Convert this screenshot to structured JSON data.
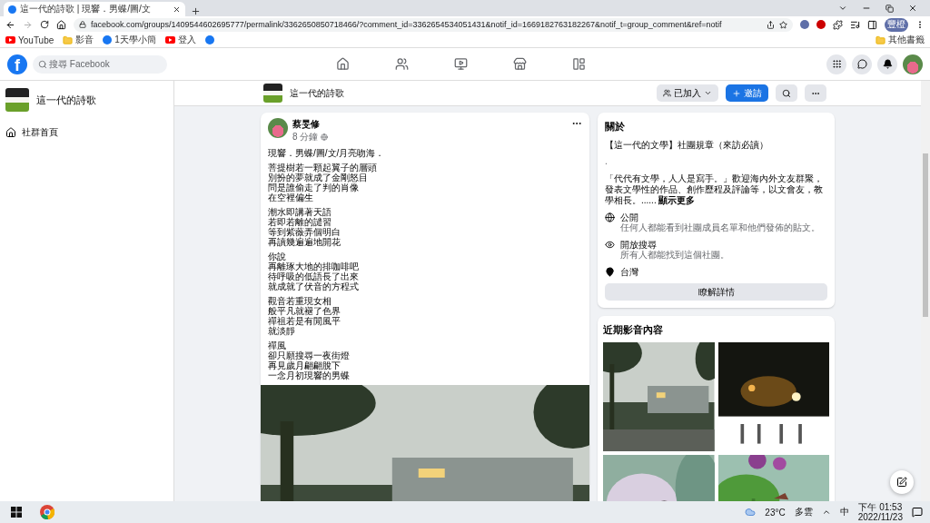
{
  "browser": {
    "tab_title": "這一代的詩歌 | 現響．男蝶/圖/文",
    "url": "facebook.com/groups/1409544602695777/permalink/3362650850718466/?comment_id=3362654534051431&notif_id=1669182763182267&notif_t=group_comment&ref=notif",
    "profile": "豐橙",
    "bookmarks": [
      {
        "kind": "youtube",
        "label": "YouTube"
      },
      {
        "kind": "folder",
        "label": "影音"
      },
      {
        "kind": "facebook",
        "label": "1天學小簡"
      },
      {
        "kind": "youtube",
        "label": "登入"
      },
      {
        "kind": "facebook"
      }
    ],
    "other_bookmarks": "其他書籤"
  },
  "header": {
    "logo": "f",
    "search_placeholder": "搜尋 Facebook"
  },
  "sidebar": {
    "group_name": "這一代的詩歌",
    "items": [
      {
        "label": "社群首頁"
      }
    ]
  },
  "group_bar": {
    "name": "這一代的詩歌",
    "joined": "已加入",
    "invite": "邀請"
  },
  "post": {
    "author": "蔡旻修",
    "time": "8 分鐘",
    "title": "現響．男蝶/圖/文/月亮吻海．",
    "stanzas": [
      [
        "菩提樹若一顆起翼子的層頭",
        "別扮的夢就成了金剛怒目",
        "問是誰偷走了判的肖像",
        "在空裡偏生"
      ],
      [
        "潮水即講著天語",
        "若即若離的譴習",
        "等到紫薇弄個明白",
        "再讀幾遍遍地開花"
      ],
      [
        "你說",
        "再離琢大地的排咖啡吧",
        "待呼吸的低語長了出來",
        "就成就了伏音的方程式"
      ],
      [
        "觀音若重現女相",
        "般平凡就褪了色界",
        "禪祖若是有閒風平",
        "就淡靜"
      ],
      [
        "禪風",
        "卻只願搜尋一夜街燈",
        "再見歲月翩翩脫下",
        "一念月初現響的男蝶"
      ]
    ],
    "image": {
      "kind": "picture"
    }
  },
  "about": {
    "heading": "關於",
    "rules_title": "【這一代的文學】社團規章（來訪必讀）",
    "dot": ".",
    "description": "「代代有文學，人人是寫手。」歡迎海內外文友群聚，發表文學性的作品、創作歷程及評論等，以文會友，教學相長。...... **顯示更多**",
    "facts": [
      {
        "kind": "public",
        "title": "公開",
        "detail": "任何人都能看到社團成員名單和他們發佈的貼文。"
      },
      {
        "kind": "visible",
        "title": "開放搜尋",
        "detail": "所有人都能找到這個社團。"
      },
      {
        "kind": "location",
        "title": "台灣"
      }
    ],
    "button": "瞭解詳情"
  },
  "media": {
    "heading": "近期影音內容",
    "items": [
      {
        "kind": "picture"
      },
      {
        "kind": "picture"
      },
      {
        "kind": "picture"
      },
      {
        "kind": "picture"
      }
    ]
  },
  "taskbar": {
    "temperature": "23°C",
    "weather": "多雲",
    "ime": "中",
    "time": "下午 01:53",
    "date": "2022/11/23"
  }
}
